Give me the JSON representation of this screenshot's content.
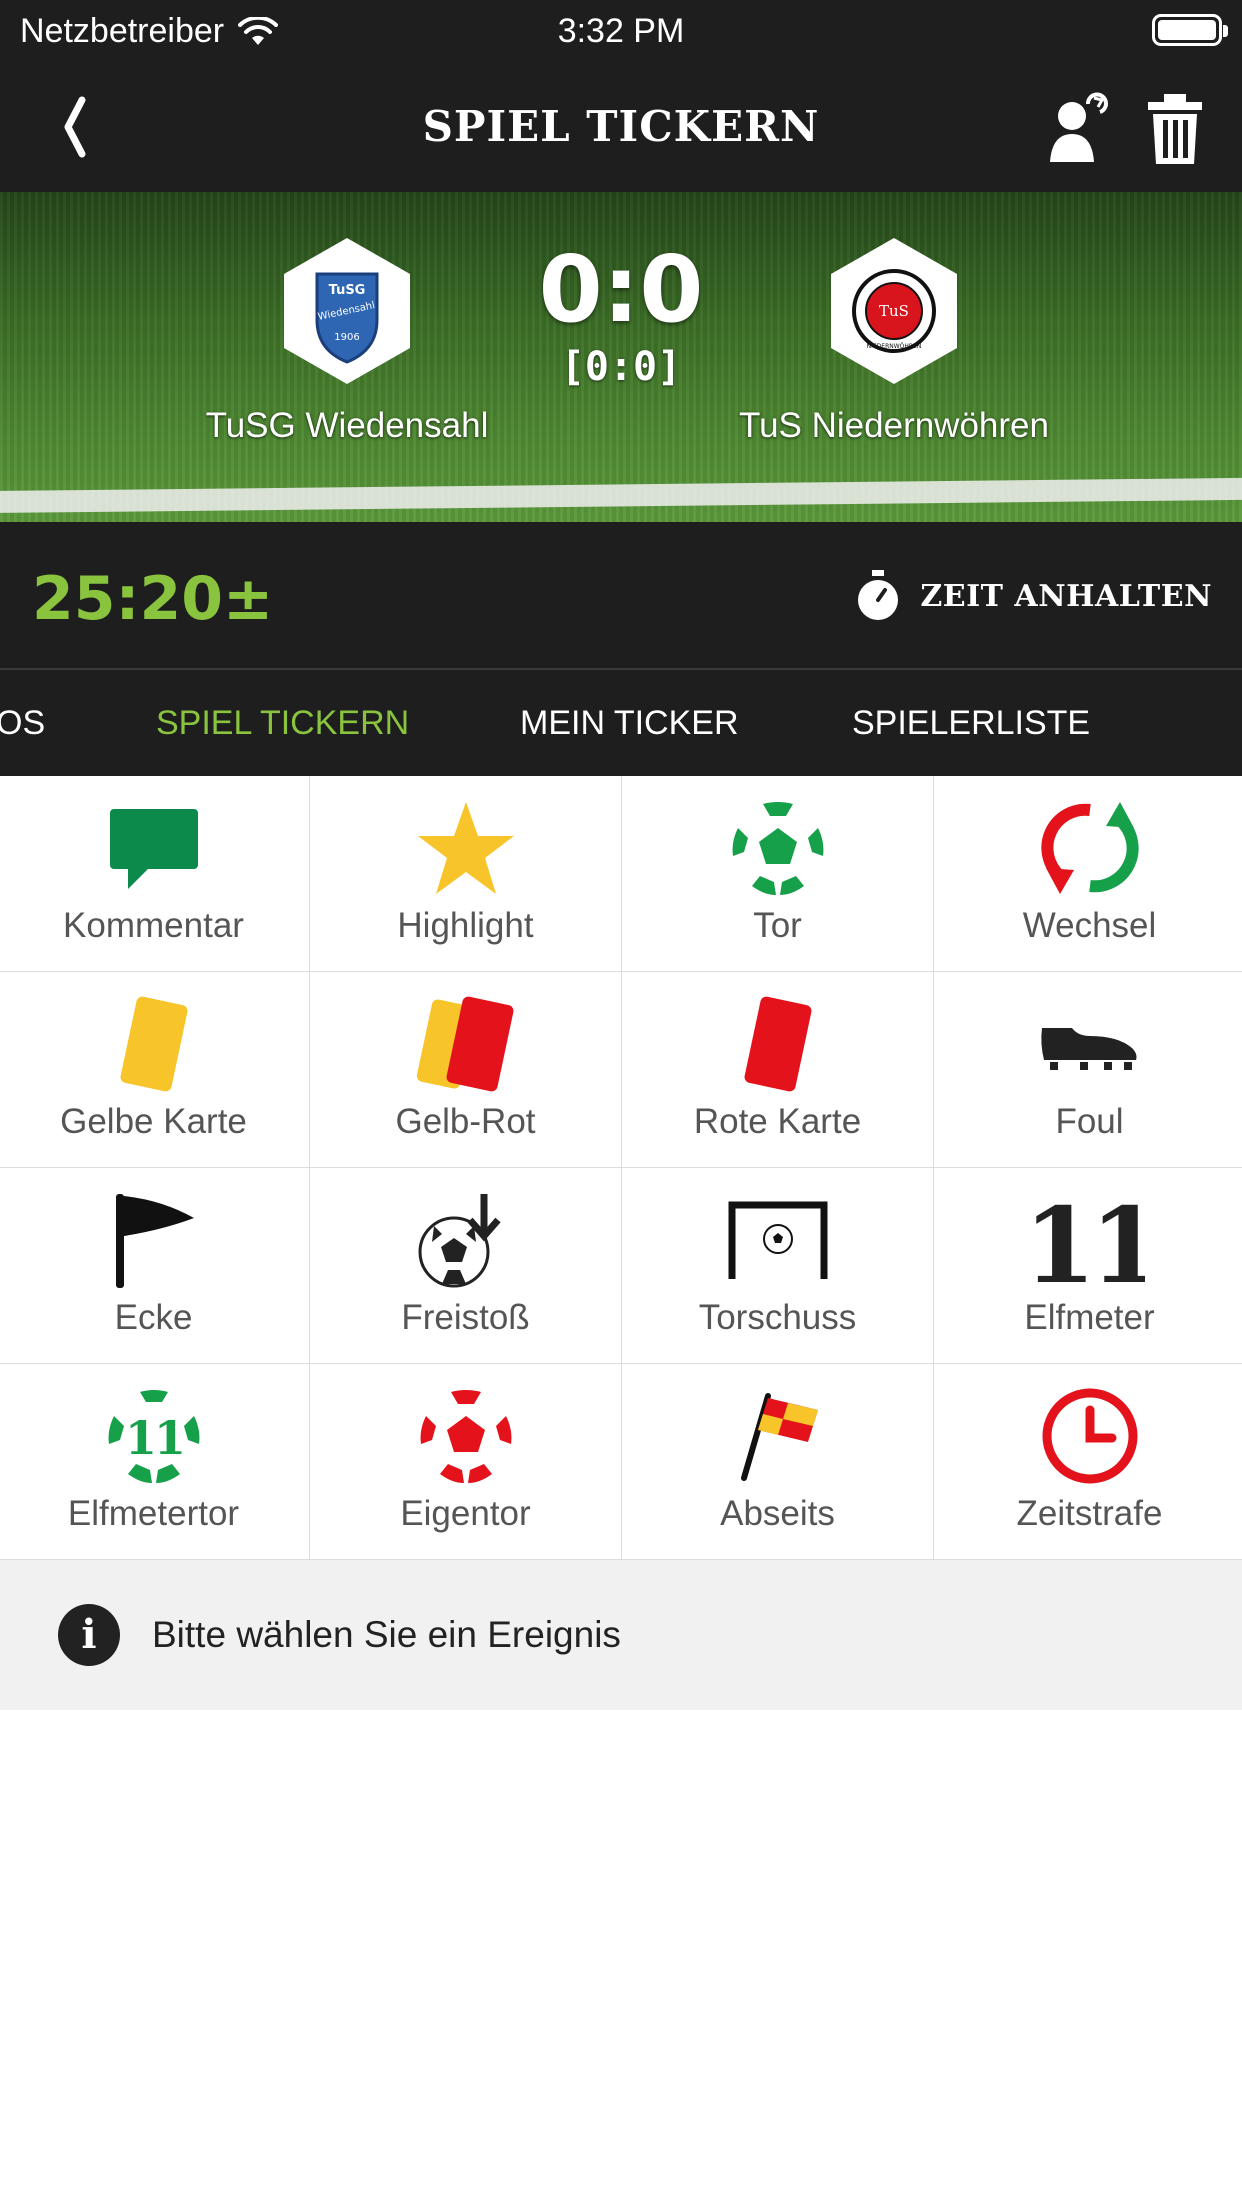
{
  "status_bar": {
    "carrier": "Netzbetreiber",
    "time": "3:32 PM"
  },
  "nav": {
    "title": "SPIEL TICKERN",
    "icons": [
      "back-icon",
      "person-refresh-icon",
      "trash-icon"
    ]
  },
  "match": {
    "home_team": "TuSG Wiedensahl",
    "away_team": "TuS Niedernwöhren",
    "score": "0:0",
    "halftime_score": "[0:0]",
    "home_logo_lettering": [
      "TuSG",
      "Wiedensahl",
      "1906"
    ],
    "away_logo_lettering": [
      "TuS",
      "NIEDERNWÖHREN"
    ]
  },
  "timer": {
    "value": "25:20±",
    "pause_label": "ZEIT ANHALTEN",
    "color": "#8ac43f"
  },
  "tabs": [
    {
      "label": "OS",
      "active": false
    },
    {
      "label": "SPIEL TICKERN",
      "active": true
    },
    {
      "label": "MEIN TICKER",
      "active": false
    },
    {
      "label": "SPIELERLISTE",
      "active": false
    }
  ],
  "events": [
    {
      "label": "Kommentar",
      "icon": "comment-icon"
    },
    {
      "label": "Highlight",
      "icon": "star-icon"
    },
    {
      "label": "Tor",
      "icon": "ball-green-icon"
    },
    {
      "label": "Wechsel",
      "icon": "substitution-icon"
    },
    {
      "label": "Gelbe Karte",
      "icon": "yellow-card-icon"
    },
    {
      "label": "Gelb-Rot",
      "icon": "yellow-red-card-icon"
    },
    {
      "label": "Rote Karte",
      "icon": "red-card-icon"
    },
    {
      "label": "Foul",
      "icon": "boot-icon"
    },
    {
      "label": "Ecke",
      "icon": "corner-flag-icon"
    },
    {
      "label": "Freistoß",
      "icon": "free-kick-icon"
    },
    {
      "label": "Torschuss",
      "icon": "goal-shot-icon"
    },
    {
      "label": "Elfmeter",
      "icon": "penalty-icon",
      "glyph": "11"
    },
    {
      "label": "Elfmetertor",
      "icon": "penalty-goal-icon",
      "glyph": "11"
    },
    {
      "label": "Eigentor",
      "icon": "own-goal-icon"
    },
    {
      "label": "Abseits",
      "icon": "offside-flag-icon"
    },
    {
      "label": "Zeitstrafe",
      "icon": "clock-icon"
    }
  ],
  "info": {
    "text": "Bitte wählen Sie ein Ereignis"
  },
  "colors": {
    "accent_green": "#8ac43f",
    "dark_bar": "#1e1e1e",
    "comment_green": "#0b8a4b",
    "star_yellow": "#f7c52a",
    "card_red": "#e3121b",
    "card_yellow": "#f7c52a"
  }
}
